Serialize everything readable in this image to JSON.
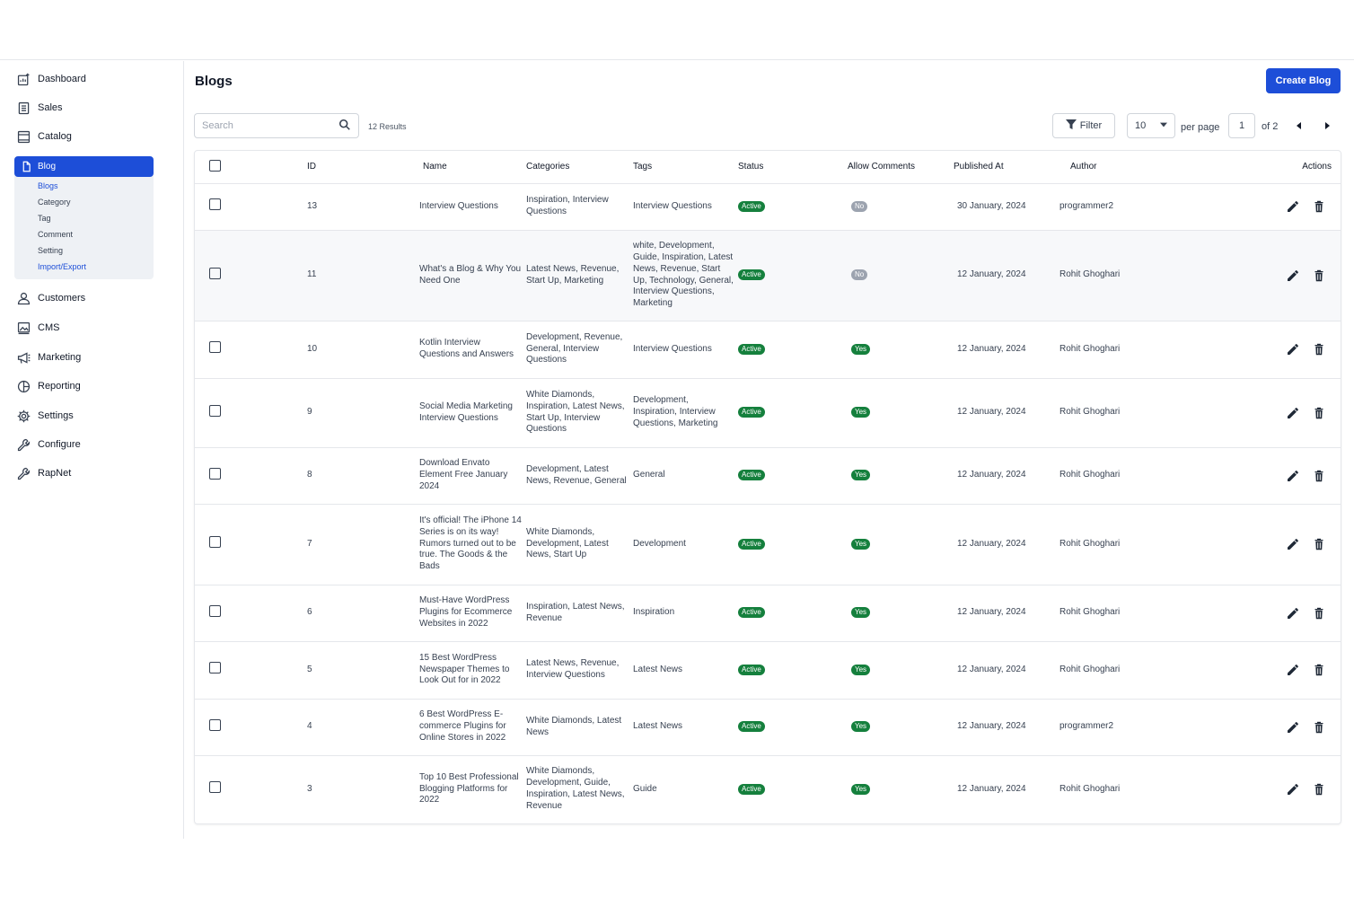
{
  "sidebar": {
    "items": [
      {
        "label": "Dashboard",
        "icon": "dashboard-icon"
      },
      {
        "label": "Sales",
        "icon": "sales-icon"
      },
      {
        "label": "Catalog",
        "icon": "catalog-icon"
      },
      {
        "label": "Blog",
        "icon": "file-icon"
      },
      {
        "label": "Customers",
        "icon": "user-icon"
      },
      {
        "label": "CMS",
        "icon": "image-icon"
      },
      {
        "label": "Marketing",
        "icon": "megaphone-icon"
      },
      {
        "label": "Reporting",
        "icon": "pie-chart-icon"
      },
      {
        "label": "Settings",
        "icon": "gear-icon"
      },
      {
        "label": "Configure",
        "icon": "wrench-icon"
      },
      {
        "label": "RapNet",
        "icon": "wrench-icon"
      }
    ],
    "blog_sub": [
      "Blogs",
      "Category",
      "Tag",
      "Comment",
      "Setting",
      "Import/Export"
    ]
  },
  "header": {
    "title": "Blogs",
    "create_label": "Create Blog"
  },
  "toolbar": {
    "search_placeholder": "Search",
    "results": "12 Results",
    "filter_label": "Filter",
    "per_page_value": "10",
    "per_page_label": "per page",
    "page_value": "1",
    "of_label": "of 2"
  },
  "table": {
    "columns": [
      "ID",
      "Name",
      "Categories",
      "Tags",
      "Status",
      "Allow Comments",
      "Published At",
      "Author",
      "Actions"
    ],
    "rows": [
      {
        "id": "13",
        "name": "Interview Questions",
        "categories": "Inspiration, Interview Questions",
        "tags": "Interview Questions",
        "status": "Active",
        "comments": "No",
        "published": "30 January, 2024",
        "author": "programmer2"
      },
      {
        "id": "11",
        "name": "What's a Blog & Why You Need One",
        "categories": "Latest News, Revenue, Start Up, Marketing",
        "tags": "white, Development, Guide, Inspiration, Latest News, Revenue, Start Up, Technology, General, Interview Questions, Marketing",
        "status": "Active",
        "comments": "No",
        "published": "12 January, 2024",
        "author": "Rohit Ghoghari"
      },
      {
        "id": "10",
        "name": "Kotlin Interview Questions and Answers",
        "categories": "Development, Revenue, General, Interview Questions",
        "tags": "Interview Questions",
        "status": "Active",
        "comments": "Yes",
        "published": "12 January, 2024",
        "author": "Rohit Ghoghari"
      },
      {
        "id": "9",
        "name": "Social Media Marketing Interview Questions",
        "categories": "White Diamonds, Inspiration, Latest News, Start Up, Interview Questions",
        "tags": "Development, Inspiration, Interview Questions, Marketing",
        "status": "Active",
        "comments": "Yes",
        "published": "12 January, 2024",
        "author": "Rohit Ghoghari"
      },
      {
        "id": "8",
        "name": "Download Envato Element Free January 2024",
        "categories": "Development, Latest News, Revenue, General",
        "tags": "General",
        "status": "Active",
        "comments": "Yes",
        "published": "12 January, 2024",
        "author": "Rohit Ghoghari"
      },
      {
        "id": "7",
        "name": "It's official! The iPhone 14 Series is on its way! Rumors turned out to be true. The Goods & the Bads",
        "categories": "White Diamonds, Development, Latest News, Start Up",
        "tags": "Development",
        "status": "Active",
        "comments": "Yes",
        "published": "12 January, 2024",
        "author": "Rohit Ghoghari"
      },
      {
        "id": "6",
        "name": "Must-Have WordPress Plugins for Ecommerce Websites in 2022",
        "categories": "Inspiration, Latest News, Revenue",
        "tags": "Inspiration",
        "status": "Active",
        "comments": "Yes",
        "published": "12 January, 2024",
        "author": "Rohit Ghoghari"
      },
      {
        "id": "5",
        "name": "15 Best WordPress Newspaper Themes to Look Out for in 2022",
        "categories": "Latest News, Revenue, Interview Questions",
        "tags": "Latest News",
        "status": "Active",
        "comments": "Yes",
        "published": "12 January, 2024",
        "author": "Rohit Ghoghari"
      },
      {
        "id": "4",
        "name": "6 Best WordPress E-commerce Plugins for Online Stores in 2022",
        "categories": "White Diamonds, Latest News",
        "tags": "Latest News",
        "status": "Active",
        "comments": "Yes",
        "published": "12 January, 2024",
        "author": "programmer2"
      },
      {
        "id": "3",
        "name": "Top 10 Best Professional Blogging Platforms for 2022",
        "categories": "White Diamonds, Development, Guide, Inspiration, Latest News, Revenue",
        "tags": "Guide",
        "status": "Active",
        "comments": "Yes",
        "published": "12 January, 2024",
        "author": "Rohit Ghoghari"
      }
    ]
  },
  "colors": {
    "primary": "#1d4ed8",
    "success": "#15803d",
    "muted": "#9ca3af"
  }
}
